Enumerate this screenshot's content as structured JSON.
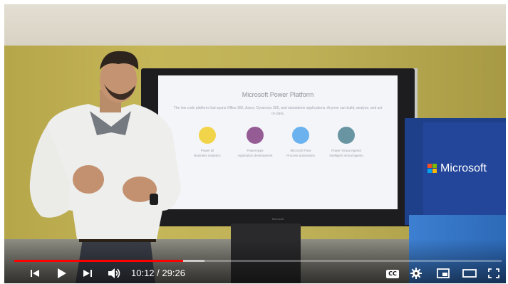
{
  "video": {
    "current_time": "10:12",
    "separator": " / ",
    "duration": "29:26",
    "progress_fraction": 0.347,
    "buffered_fraction": 0.39
  },
  "player_controls": {
    "previous": "previous-icon",
    "play": "play-icon",
    "next": "next-icon",
    "volume": "volume-icon",
    "captions_label": "CC",
    "settings": "gear-icon",
    "miniplayer": "miniplayer-icon",
    "theater": "theater-icon",
    "fullscreen": "fullscreen-icon"
  },
  "scene": {
    "screen_title": "Microsoft Power Platform",
    "screen_subtitle": "The low code platform that spans Office 365, Azure, Dynamics 365, and standalone applications. Anyone can build, analyze, and act on data.",
    "apps": [
      {
        "name": "Power BI",
        "desc": "Business analytics",
        "color": "#f2c811"
      },
      {
        "name": "PowerApps",
        "desc": "Application development",
        "color": "#742774"
      },
      {
        "name": "Microsoft Flow",
        "desc": "Process automation",
        "color": "#0f85e8"
      },
      {
        "name": "Power Virtual Agents",
        "desc": "Intelligent virtual agents",
        "color": "#0b556a"
      }
    ],
    "screen_brand": "Microsoft",
    "sign_text": "Microsoft"
  },
  "colors": {
    "progress": "#ff0000",
    "ms_red": "#f25022",
    "ms_green": "#7fba00",
    "ms_blue": "#00a4ef",
    "ms_yellow": "#ffb900"
  }
}
